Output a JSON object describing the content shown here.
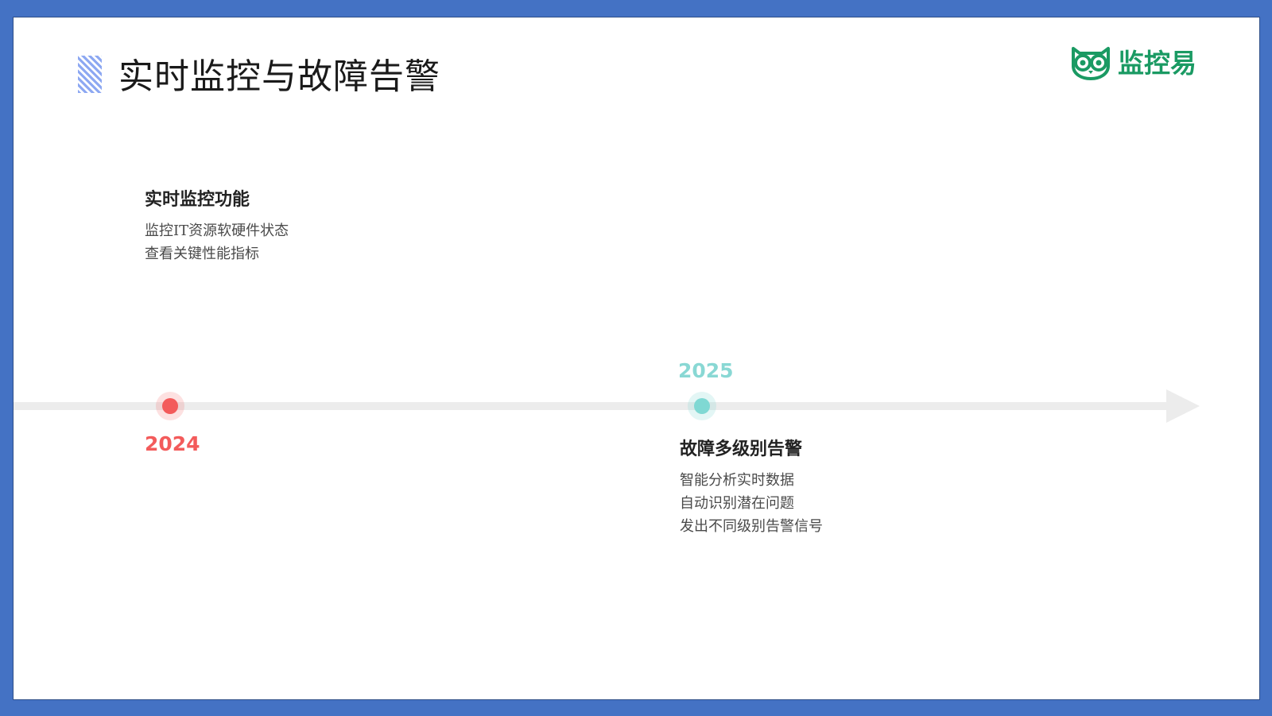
{
  "slide": {
    "title": "实时监控与故障告警"
  },
  "logo": {
    "text": "监控易",
    "brand_color": "#1a9a63"
  },
  "timeline": {
    "line_color": "#ececec",
    "events": [
      {
        "year": "2024",
        "color": "#f35b5b",
        "heading": "实时监控功能",
        "lines": [
          "监控IT资源软硬件状态",
          "查看关键性能指标"
        ]
      },
      {
        "year": "2025",
        "color": "#7fd8d3",
        "heading": "故障多级别告警",
        "lines": [
          "智能分析实时数据",
          "自动识别潜在问题",
          "发出不同级别告警信号"
        ]
      }
    ]
  },
  "frame": {
    "border_color": "#4472c4"
  }
}
